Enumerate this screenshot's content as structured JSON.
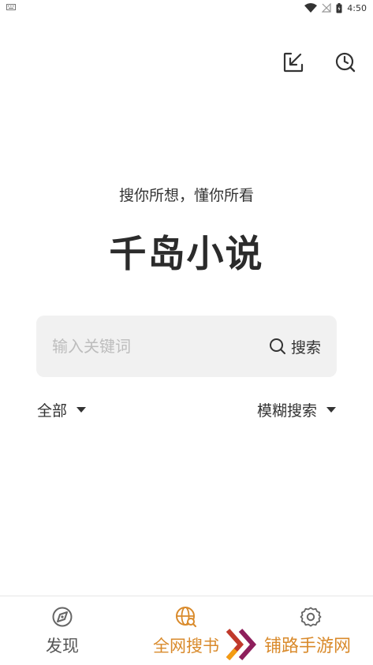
{
  "status_bar": {
    "time": "4:50"
  },
  "header": {
    "download_icon": "download-icon",
    "history_icon": "clock-icon"
  },
  "hero": {
    "tagline": "搜你所想，懂你所看",
    "title": "千岛小说"
  },
  "search": {
    "placeholder": "输入关键词",
    "value": "",
    "button_label": "搜索"
  },
  "filters": {
    "scope": "全部",
    "mode": "模糊搜索"
  },
  "bottom_nav": {
    "items": [
      {
        "label": "发现",
        "icon": "compass-icon",
        "active": false
      },
      {
        "label": "全网搜书",
        "icon": "globe-search-icon",
        "active": true
      },
      {
        "label": "设置",
        "icon": "gear-icon",
        "active": false
      }
    ]
  },
  "watermark": {
    "text": "铺路手游网"
  },
  "colors": {
    "accent": "#d98a2b",
    "text": "#333333",
    "search_bg": "#f1f1f1",
    "placeholder": "#bdbdbd"
  }
}
